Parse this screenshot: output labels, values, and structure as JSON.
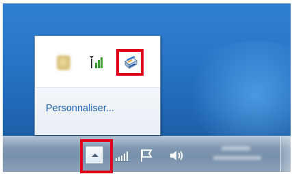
{
  "popup": {
    "customize_label": "Personnaliser...",
    "icons": [
      {
        "name": "blurred-app-icon"
      },
      {
        "name": "network-signal-icon"
      },
      {
        "name": "printer-icon"
      }
    ]
  },
  "taskbar": {
    "expand_button": {
      "icon": "chevron-up-icon"
    },
    "tray_icons": [
      {
        "name": "network-signal-icon"
      },
      {
        "name": "action-center-flag-icon"
      },
      {
        "name": "volume-icon"
      }
    ],
    "clock_visible": false
  },
  "colors": {
    "desktop": "#2a77c8",
    "taskbar": "#7f97b1",
    "link": "#1a5fb4",
    "highlight": "#e0001a",
    "popup_footer": "#e8eef5"
  }
}
